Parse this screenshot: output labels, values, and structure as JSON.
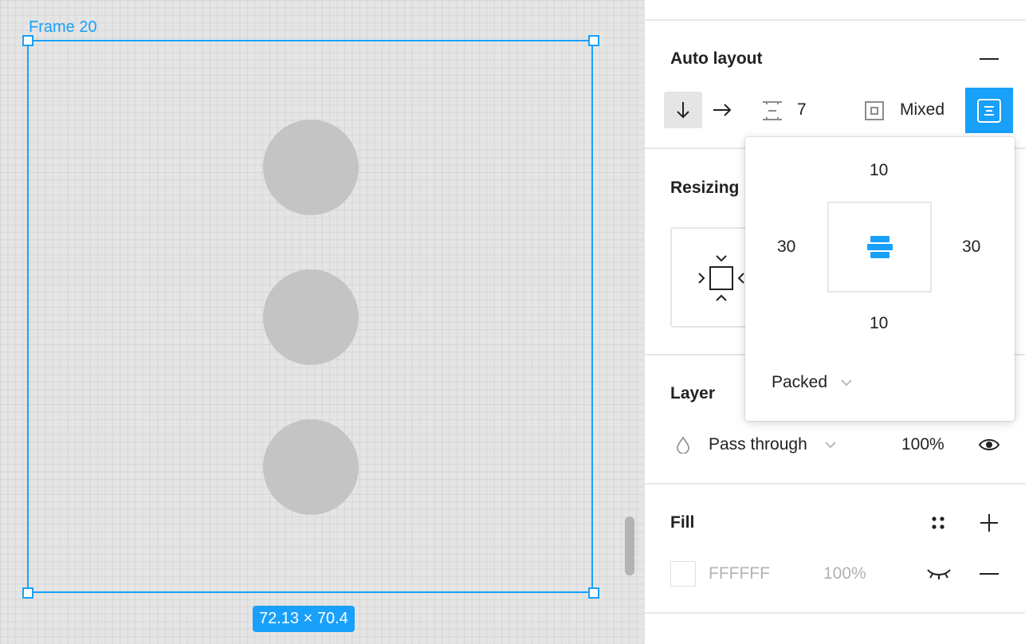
{
  "canvas": {
    "frame_label": "Frame 20",
    "size_badge": "72.13 × 70.4",
    "accent": "#18a0fb",
    "dot_color": "#c4c4c4"
  },
  "auto_layout": {
    "title": "Auto layout",
    "collapse_icon": "minus-icon",
    "direction_vertical_icon": "arrow-down-icon",
    "direction_horizontal_icon": "arrow-right-icon",
    "spacing_icon": "spacing-icon",
    "spacing_value": "7",
    "padding_icon": "padding-icon",
    "padding_value": "Mixed",
    "alignment_icon": "align-icon"
  },
  "resizing": {
    "title": "Resizing"
  },
  "layer": {
    "title": "Layer",
    "blend_icon": "drop-icon",
    "blend_mode": "Pass through",
    "opacity": "100%",
    "visibility_icon": "eye-icon"
  },
  "fill": {
    "title": "Fill",
    "styles_icon": "styles-icon",
    "add_icon": "plus-icon",
    "color_hex": "FFFFFF",
    "opacity": "100%",
    "hidden_icon": "eye-closed-icon",
    "remove_icon": "minus-icon"
  },
  "padding_popover": {
    "top": "10",
    "left": "30",
    "right": "30",
    "bottom": "10",
    "distribution": "Packed",
    "chevron_icon": "chevron-down-icon"
  }
}
